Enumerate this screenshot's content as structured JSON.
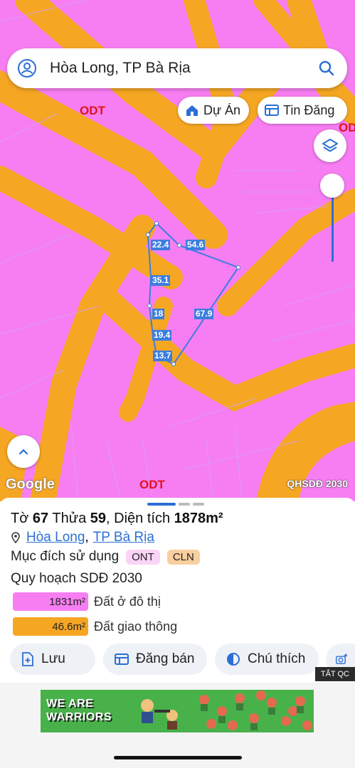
{
  "search": {
    "text": "Hòa Long, TP Bà Rịa"
  },
  "pills": {
    "du_an": "Dự Án",
    "tin_dang": "Tin Đăng"
  },
  "map": {
    "zone_labels": [
      "ODT",
      "ODT",
      "ODT"
    ],
    "dimensions": [
      "22.4",
      "54.6",
      "35.1",
      "67.9",
      "18",
      "19.4",
      "13.7"
    ],
    "google": "Google",
    "plan_label": "QHSDĐ 2030",
    "colors": {
      "residential": "#f77ef2",
      "road": "#f5a623",
      "parcel_line": "#3c7ee0"
    }
  },
  "parcel": {
    "to_label": "Tờ",
    "to_value": "67",
    "thua_label": "Thửa",
    "thua_value": "59",
    "area_label": "Diện tích",
    "area_value": "1878m²",
    "ward": "Hòa Long",
    "city": "TP Bà Rịa",
    "purpose_label": "Mục đích sử dụng",
    "purpose_tags": [
      "ONT",
      "CLN"
    ],
    "plan_title": "Quy hoạch SDĐ 2030",
    "legend": [
      {
        "value": "1831m²",
        "label": "Đất ở đô thị",
        "color": "#f77ef2"
      },
      {
        "value": "46.6m²",
        "label": "Đất giao thông",
        "color": "#f5a623"
      }
    ]
  },
  "actions": {
    "save": "Lưu",
    "post": "Đăng bán",
    "note": "Chú thích"
  },
  "ad": {
    "close_label": "TẮT QC",
    "banner_text": "WE ARE WARRIORS"
  }
}
